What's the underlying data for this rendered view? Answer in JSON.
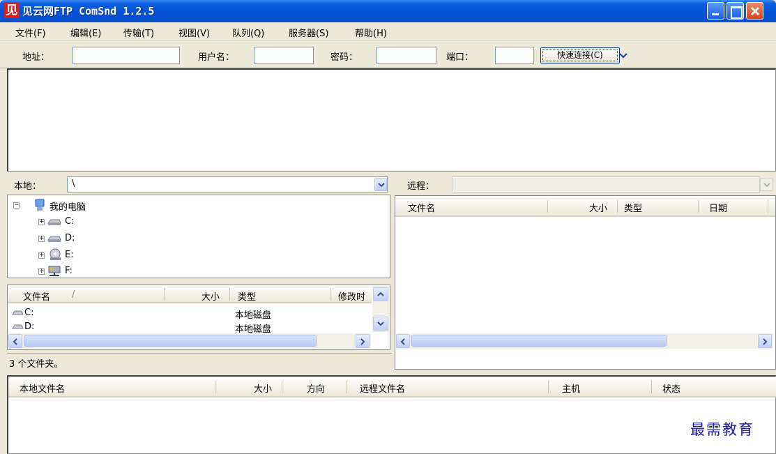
{
  "window": {
    "icon_text": "见",
    "title": "见云网FTP ComSnd 1.2.5"
  },
  "menu": [
    "文件(F)",
    "编辑(E)",
    "传输(T)",
    "视图(V)",
    "队列(Q)",
    "服务器(S)",
    "帮助(H)"
  ],
  "toolbar": {
    "address_label": "地址：",
    "address_value": "",
    "username_label": "用户名：",
    "username_value": "",
    "password_label": "密码：",
    "password_value": "",
    "port_label": "端口：",
    "port_value": "",
    "quick_connect_label": "快速连接(C)"
  },
  "local": {
    "label": "本地：",
    "path": "\\",
    "tree": {
      "root": "我的电脑",
      "drives": [
        "C:",
        "D:",
        "E:",
        "F:"
      ]
    },
    "columns": [
      "文件名",
      "大小",
      "类型",
      "修改时"
    ],
    "sort_indicator": "/",
    "rows": [
      {
        "name": "C:",
        "type": "本地磁盘"
      },
      {
        "name": "D:",
        "type": "本地磁盘"
      }
    ],
    "status": "3 个文件夹。"
  },
  "remote": {
    "label": "远程：",
    "path": "",
    "columns": [
      "文件名",
      "大小",
      "类型",
      "日期"
    ]
  },
  "queue": {
    "columns": [
      "本地文件名",
      "大小",
      "方向",
      "远程文件名",
      "主机",
      "状态"
    ]
  },
  "watermark": "最需教育",
  "colors": {
    "title_bar": "#0552d8",
    "window_bg": "#ece9d8",
    "close_button": "#d8421c",
    "watermark": "#1a1aa8"
  }
}
